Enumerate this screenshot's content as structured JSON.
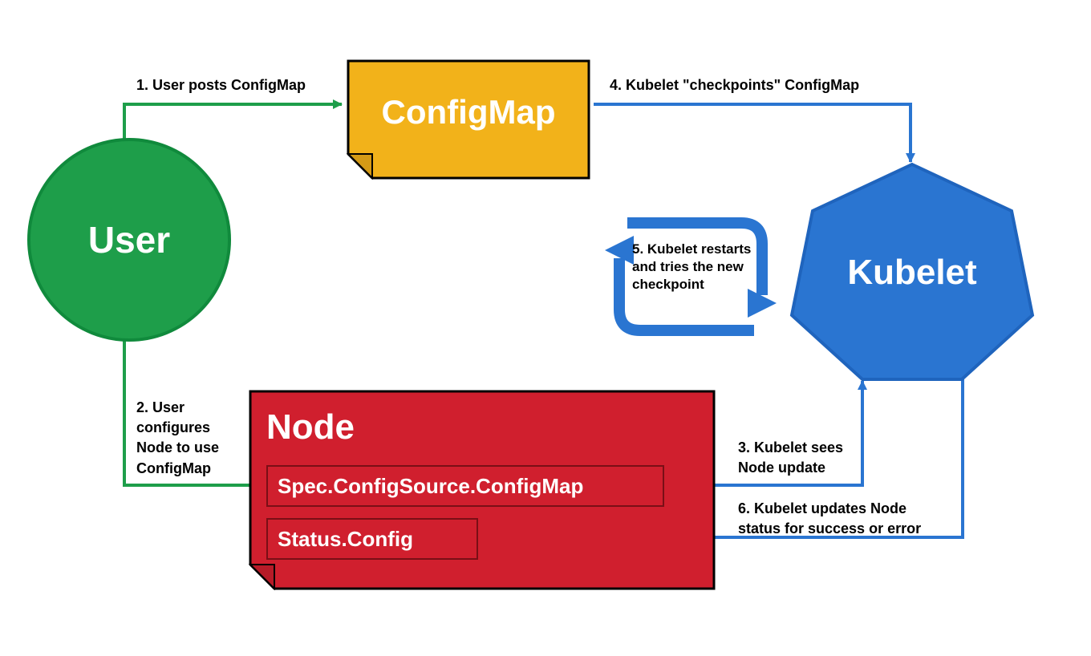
{
  "user": {
    "label": "User"
  },
  "configmap": {
    "label": "ConfigMap"
  },
  "kubelet": {
    "label": "Kubelet"
  },
  "node": {
    "label": "Node",
    "spec": "Spec.ConfigSource.ConfigMap",
    "status": "Status.Config"
  },
  "restart_box": {
    "text": "5. Kubelet restarts and tries the new checkpoint"
  },
  "steps": {
    "s1": "1. User posts ConfigMap",
    "s2": "2. User\nconfigures\nNode to use\nConfigMap",
    "s3": "3. Kubelet sees\nNode update",
    "s4": "4. Kubelet \"checkpoints\" ConfigMap",
    "s6": "6. Kubelet updates Node\nstatus for success or error"
  },
  "colors": {
    "green": "#1e9e4a",
    "green_stroke": "#0e8d39",
    "orange": "#f2b21a",
    "orange_fold": "#d49a16",
    "red": "#d01f2e",
    "red_fold": "#b71b28",
    "blue": "#2a75d1",
    "blue_stroke": "#1f64bd",
    "arrow_green": "#1e9e4a",
    "arrow_blue": "#2a75d1"
  }
}
